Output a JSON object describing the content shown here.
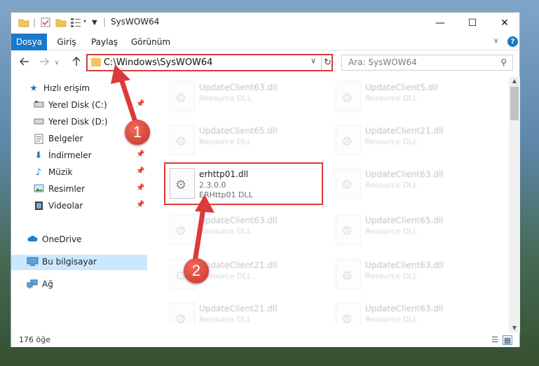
{
  "window": {
    "title": "SysWOW64",
    "controls": {
      "minimize": "—",
      "maximize": "☐",
      "close": "✕"
    }
  },
  "ribbon": {
    "tabs": [
      {
        "label": "Dosya",
        "active": true
      },
      {
        "label": "Giriş"
      },
      {
        "label": "Paylaş"
      },
      {
        "label": "Görünüm"
      }
    ],
    "expand_icon": "chevron-down-icon",
    "help_icon": "help-icon"
  },
  "nav": {
    "address": "C:\\Windows\\SysWOW64",
    "search_placeholder": "Ara: SysWOW64"
  },
  "sidebar": {
    "items": [
      {
        "label": "Hızlı erişim",
        "icon": "star-icon"
      },
      {
        "label": "Yerel Disk (C:)",
        "icon": "drive-icon",
        "pinned": true
      },
      {
        "label": "Yerel Disk (D:)",
        "icon": "drive-icon"
      },
      {
        "label": "Belgeler",
        "icon": "documents-icon"
      },
      {
        "label": "İndirmeler",
        "icon": "download-icon",
        "pinned": true
      },
      {
        "label": "Müzik",
        "icon": "music-icon",
        "pinned": true
      },
      {
        "label": "Resimler",
        "icon": "pictures-icon",
        "pinned": true
      },
      {
        "label": "Videolar",
        "icon": "videos-icon",
        "pinned": true
      },
      {
        "label": "OneDrive",
        "icon": "cloud-icon"
      },
      {
        "label": "Bu bilgisayar",
        "icon": "computer-icon",
        "selected": true
      },
      {
        "label": "Ağ",
        "icon": "network-icon"
      }
    ]
  },
  "files": {
    "highlighted": {
      "name": "erhttp01.dll",
      "version": "2.3.0.0",
      "description": "ERHttp01 DLL"
    },
    "left_column": [
      {
        "name": "UpdateClient63.dll",
        "type": "Resource DLL"
      },
      {
        "name": "UpdateClient65.dll",
        "type": "Resource DLL"
      },
      {
        "name": "UpdateClient63.dll",
        "type": "Resource DLL"
      },
      {
        "name": "UpdateClient21.dll",
        "type": "Resource DLL"
      },
      {
        "name": "UpdateClient21.dll",
        "type": "Resource DLL"
      }
    ],
    "right_column": [
      {
        "name": "UpdateClient5.dll",
        "type": "Resource DLL"
      },
      {
        "name": "UpdateClient21.dll",
        "type": "Resource DLL"
      },
      {
        "name": "UpdateClient63.dll",
        "type": "Resource DLL"
      },
      {
        "name": "UpdateClient65.dll",
        "type": "Resource DLL"
      },
      {
        "name": "UpdateClient63.dll",
        "type": "Resource DLL"
      },
      {
        "name": "UpdateClient63.dll",
        "type": "Resource DLL"
      }
    ]
  },
  "status": {
    "item_count": "176 öğe"
  },
  "callouts": [
    {
      "number": "1"
    },
    {
      "number": "2"
    }
  ],
  "colors": {
    "accent": "#1979ca",
    "highlight_border": "#d93a3a",
    "badge": "#d9443a",
    "selection": "#cce8ff"
  }
}
